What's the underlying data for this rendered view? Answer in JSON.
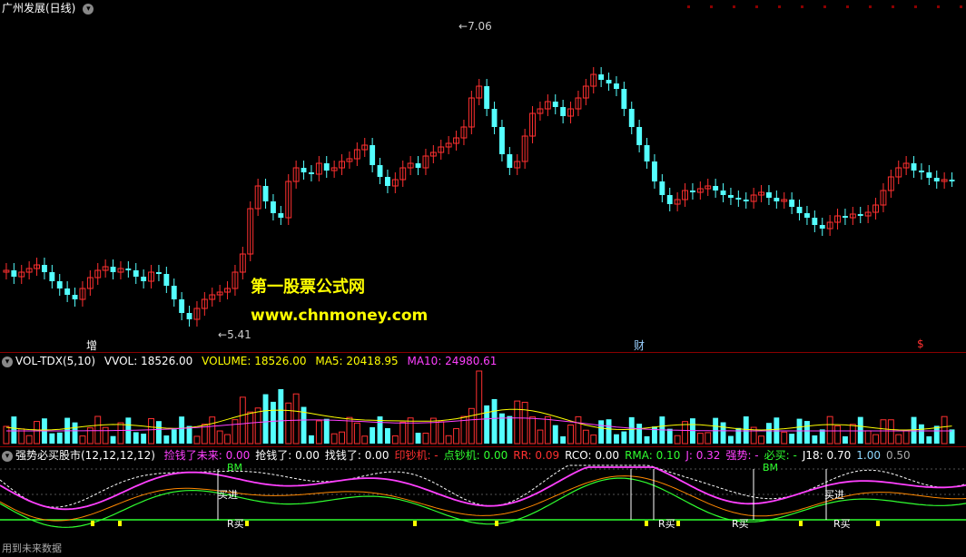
{
  "main": {
    "title": "广州发展(日线)",
    "high_label": "7.06",
    "low_label": "5.41",
    "watermark_cn": "第一股票公式网",
    "watermark_url": "www.chnmoney.com",
    "markers": [
      {
        "text": "增",
        "color": "#ffffff"
      },
      {
        "text": "财",
        "color": "#9ad0ff"
      },
      {
        "text": "$",
        "color": "#ff3030"
      }
    ]
  },
  "volume": {
    "name": "VOL-TDX(5,10)",
    "vvol": "VVOL: 18526.00",
    "volume": "VOLUME: 18526.00",
    "ma5": "MA5: 20418.95",
    "ma10": "MA10: 24980.61"
  },
  "indicator": {
    "name": "强势必买股市(12,12,12,12)",
    "items": [
      {
        "text": "捡钱了未来: 0.00",
        "color": "#ff40ff"
      },
      {
        "text": "抢钱了: 0.00",
        "color": "#ffffff"
      },
      {
        "text": "找钱了: 0.00",
        "color": "#ffffff"
      },
      {
        "text": "印钞机: -",
        "color": "#ff3030"
      },
      {
        "text": "点钞机: 0.00",
        "color": "#30ff30"
      },
      {
        "text": "RR: 0.09",
        "color": "#ff3030"
      },
      {
        "text": "RCO: 0.00",
        "color": "#ffffff"
      },
      {
        "text": "RMA: 0.10",
        "color": "#30ff30"
      },
      {
        "text": "J: 0.32",
        "color": "#ff40ff"
      },
      {
        "text": "强势: -",
        "color": "#ff40ff"
      },
      {
        "text": "必买: -",
        "color": "#30ff30"
      },
      {
        "text": "J18: 0.70",
        "color": "#ffffff"
      },
      {
        "text": "1.00",
        "color": "#8fd8ff"
      },
      {
        "text": "0.50",
        "color": "#aaaaaa"
      }
    ],
    "labels": {
      "bm": "BM",
      "mairu": "买进",
      "rmai": "R买"
    }
  },
  "footer": "用到未来数据",
  "colors": {
    "up": "#ff3030",
    "down": "#54ffff",
    "vwhite": "#e0e0e0",
    "vyellow": "#ffff00",
    "vmagenta": "#ff40ff"
  }
}
